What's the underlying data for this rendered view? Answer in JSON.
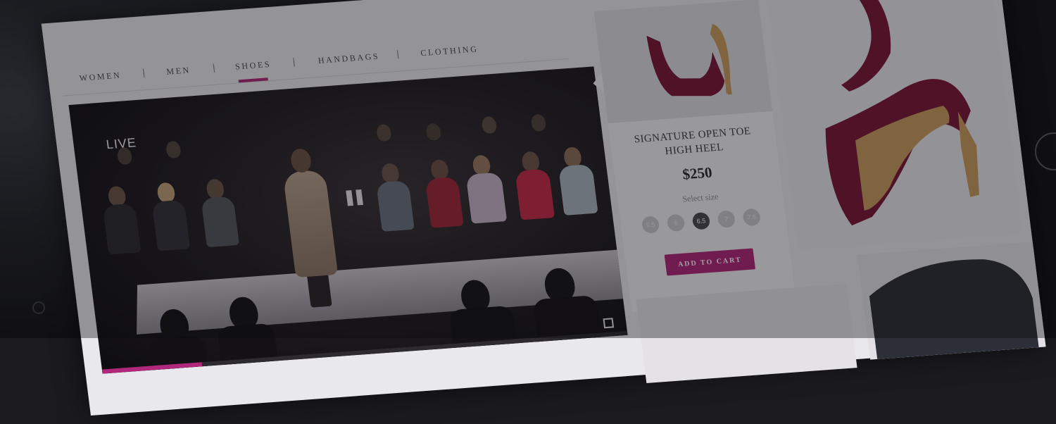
{
  "nav": {
    "items": [
      "WOMEN",
      "MEN",
      "SHOES",
      "HANDBAGS",
      "CLOTHING"
    ],
    "active": "SHOES"
  },
  "video": {
    "live_label": "LIVE",
    "progress_fraction": 0.19
  },
  "product": {
    "title_line1": "SIGNATURE OPEN TOE",
    "title_line2": "HIGH HEEL",
    "price": "$250",
    "select_size_label": "Select size",
    "sizes": [
      "5.5",
      "6",
      "6.5",
      "7",
      "7.5"
    ],
    "selected_size": "6.5",
    "add_to_cart_label": "ADD TO CART"
  },
  "colors": {
    "accent": "#b0277b",
    "shoe": "#7a1838",
    "heel": "#c99a5e"
  },
  "icons": [
    "pause-icon",
    "fullscreen-icon"
  ]
}
